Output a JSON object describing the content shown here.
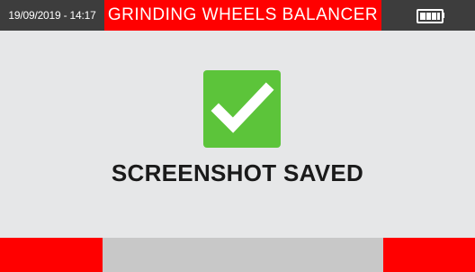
{
  "status_bar": {
    "datetime": "19/09/2019 - 14:17",
    "title": "GRINDING WHEELS BALANCER",
    "battery_icon": "battery-full-icon",
    "battery_level": 1.0
  },
  "dialog": {
    "icon": "checkmark-icon",
    "message": "SCREENSHOT SAVED"
  },
  "softkeys": {
    "left_label": "",
    "middle_label": "",
    "right_label": ""
  },
  "colors": {
    "header_bg": "#3d3d3d",
    "accent_red": "#ff0000",
    "success_green": "#5cc43a",
    "background": "#e6e7e8",
    "softkey_gray": "#c8c8c8"
  }
}
